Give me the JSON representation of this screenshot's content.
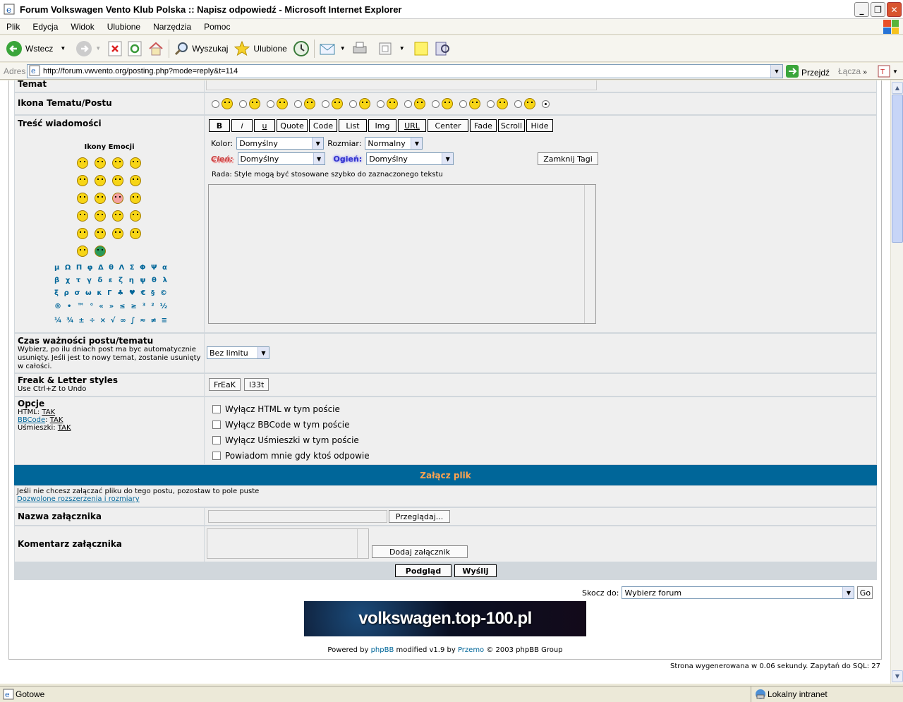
{
  "window": {
    "title": "Forum Volkswagen Vento Klub Polska :: Napisz odpowiedź - Microsoft Internet Explorer"
  },
  "menu": [
    "Plik",
    "Edycja",
    "Widok",
    "Ulubione",
    "Narzędzia",
    "Pomoc"
  ],
  "toolbar": {
    "back": "Wstecz",
    "search": "Wyszukaj",
    "favorites": "Ulubione"
  },
  "address": {
    "label": "Adres",
    "url": "http://forum.vwvento.org/posting.php?mode=reply&t=114",
    "go": "Przejdź",
    "links": "Łącza"
  },
  "form": {
    "topic_label": "Temat",
    "icon_label": "Ikona Tematu/Postu",
    "message_label": "Treść wiadomości",
    "emoticons_title": "Ikony Emocji",
    "bbcode_buttons": [
      "B",
      "i",
      "u",
      "Quote",
      "Code",
      "List",
      "Img",
      "URL",
      "Center",
      "Fade",
      "Scroll",
      "Hide"
    ],
    "color_label": "Kolor:",
    "color_value": "Domyślny",
    "size_label": "Rozmiar:",
    "size_value": "Normalny",
    "shadow_label": "Cień:",
    "shadow_value": "Domyślny",
    "glow_label": "Ogień:",
    "glow_value": "Domyślny",
    "close_tags": "Zamknij Tagi",
    "tip": "Rada: Style mogą być stosowane szybko do zaznaczonego tekstu",
    "symbols": [
      [
        "μ",
        "Ω",
        "Π",
        "φ",
        "Δ",
        "θ",
        "Λ",
        "Σ",
        "Φ",
        "Ψ",
        "α"
      ],
      [
        "β",
        "χ",
        "τ",
        "γ",
        "δ",
        "ε",
        "ζ",
        "η",
        "ψ",
        "θ",
        "λ"
      ],
      [
        "ξ",
        "ρ",
        "σ",
        "ω",
        "κ",
        "Γ",
        "♣",
        "♥",
        "€",
        "§",
        "©"
      ],
      [
        "®",
        "•",
        "™",
        "°",
        "«",
        "»",
        "≤",
        "≥",
        "³",
        "²",
        "½"
      ],
      [
        "¼",
        "¾",
        "±",
        "÷",
        "×",
        "√",
        "∞",
        "∫",
        "≈",
        "≠",
        "≡"
      ]
    ],
    "expiry_label": "Czas ważności postu/tematu",
    "expiry_desc": "Wybierz, po ilu dniach post ma byc automatycznie usunięty. Jeśli jest to nowy temat, zostanie usunięty w całości.",
    "expiry_value": "Bez limitu",
    "freak_label": "Freak & Letter styles",
    "freak_desc": "Use Ctrl+Z to Undo",
    "freak_btn": "FrEaK",
    "l33t_btn": "l33t",
    "options_label": "Opcje",
    "html_label": "HTML:",
    "html_value": "TAK",
    "bbcode_label": "BBCode",
    "bbcode_value": "TAK",
    "smilies_label": "Uśmieszki:",
    "smilies_value": "TAK",
    "opt_html": "Wyłącz HTML w tym poście",
    "opt_bbcode": "Wyłącz BBCode w tym poście",
    "opt_smilies": "Wyłącz Uśmieszki w tym poście",
    "opt_notify": "Powiadom mnie gdy ktoś odpowie",
    "attach_title": "Załącz plik",
    "attach_desc": "Jeśli nie chcesz załączać pliku do tego postu, pozostaw to pole puste",
    "attach_link": "Dozwolone rozszerzenia i rozmiary",
    "attach_name_label": "Nazwa załącznika",
    "browse_btn": "Przeglądaj...",
    "attach_comment_label": "Komentarz załącznika",
    "add_attach_btn": "Dodaj załącznik",
    "preview_btn": "Podgląd",
    "submit_btn": "Wyślij"
  },
  "jump": {
    "label": "Skocz do:",
    "value": "Wybierz forum",
    "go": "Go"
  },
  "banner": {
    "text": "volkswagen.top-100.pl"
  },
  "footer": {
    "powered_prefix": "Powered by",
    "phpbb": "phpBB",
    "modified": "modified v1.9 by",
    "przemo": "Przemo",
    "copyright": "© 2003 phpBB Group",
    "generated": "Strona wygenerowana w 0.06 sekundy. Zapytań do SQL: 27"
  },
  "status": {
    "left": "Gotowe",
    "right": "Lokalny intranet"
  },
  "colors": {
    "accent": "#006699",
    "cat_text": "#ffa34f",
    "row_bg": "#efefef",
    "border": "#d1d7dc"
  }
}
